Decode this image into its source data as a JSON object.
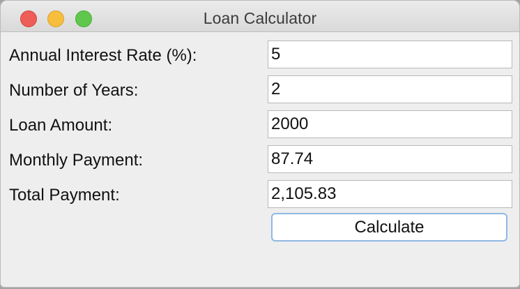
{
  "window": {
    "title": "Loan Calculator"
  },
  "form": {
    "rows": [
      {
        "label": "Annual Interest Rate (%):",
        "value": "5"
      },
      {
        "label": "Number of Years:",
        "value": "2"
      },
      {
        "label": "Loan Amount:",
        "value": "2000"
      },
      {
        "label": "Monthly Payment:",
        "value": "87.74"
      },
      {
        "label": "Total Payment:",
        "value": "2,105.83"
      }
    ],
    "calculate_label": "Calculate"
  },
  "colors": {
    "close": "#ee5d57",
    "minimize": "#f6bd3f",
    "zoom": "#5fc84c",
    "button_focus_border": "#8fb8e4"
  }
}
